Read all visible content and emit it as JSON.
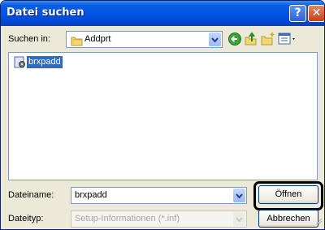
{
  "window": {
    "title": "Datei suchen"
  },
  "titlebar": {
    "help_label": "?",
    "close_label": "✕"
  },
  "location": {
    "label": "Suchen in:",
    "current_folder": "Addprt"
  },
  "toolbar": {
    "tools": [
      "back-icon",
      "up-folder-icon",
      "new-folder-icon",
      "view-menu-icon"
    ]
  },
  "files": [
    {
      "name": "brxpadd",
      "icon": "setup-file-icon",
      "selected": true
    }
  ],
  "filename": {
    "label": "Dateiname:",
    "value": "brxpadd"
  },
  "filetype": {
    "label": "Dateityp:",
    "value": "Setup-Informationen (*.inf)"
  },
  "buttons": {
    "open_label": "Öffnen",
    "cancel_label": "Abbrechen"
  },
  "colors": {
    "titlebar": "#0055e5",
    "dialog_bg": "#ece9d8",
    "selection": "#316ac5",
    "close_button": "#c93f14"
  }
}
